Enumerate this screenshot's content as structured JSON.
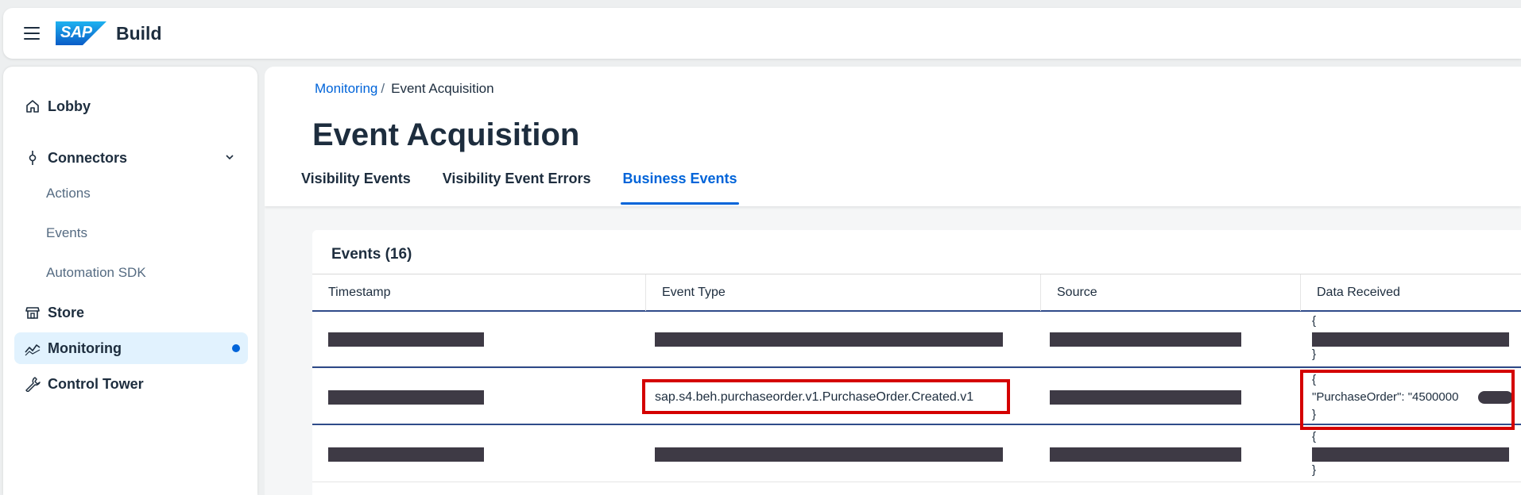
{
  "shell": {
    "logo": "SAP",
    "app_name": "Build"
  },
  "sidebar": {
    "items": [
      {
        "label": "Lobby",
        "icon": "home-icon"
      },
      {
        "label": "Connectors",
        "icon": "connector-icon"
      },
      {
        "label": "Store",
        "icon": "store-icon"
      },
      {
        "label": "Monitoring",
        "icon": "monitoring-icon",
        "selected": true
      },
      {
        "label": "Control Tower",
        "icon": "wrench-icon"
      }
    ],
    "sub_items": [
      "Actions",
      "Events",
      "Automation SDK"
    ]
  },
  "breadcrumb": {
    "link": "Monitoring",
    "separator": "/",
    "current": "Event Acquisition"
  },
  "page_title": "Event Acquisition",
  "tabs": [
    {
      "label": "Visibility Events",
      "active": false
    },
    {
      "label": "Visibility Event Errors",
      "active": false
    },
    {
      "label": "Business Events",
      "active": true
    }
  ],
  "table": {
    "title": "Events (16)",
    "columns": [
      "Timestamp",
      "Event Type",
      "Source",
      "Data Received"
    ],
    "rows": [
      {
        "event_type": "",
        "json_open": "{",
        "json_body": "",
        "json_close": "}"
      },
      {
        "event_type": "sap.s4.beh.purchaseorder.v1.PurchaseOrder.Created.v1",
        "json_open": "{",
        "json_body": "\"PurchaseOrder\": \"4500000",
        "json_close": "}"
      },
      {
        "event_type": "",
        "json_open": "{",
        "json_body": "",
        "json_close": "}"
      }
    ]
  },
  "colors": {
    "accent": "#0064d9",
    "highlight": "#d40000",
    "redaction": "#3e3a45"
  }
}
